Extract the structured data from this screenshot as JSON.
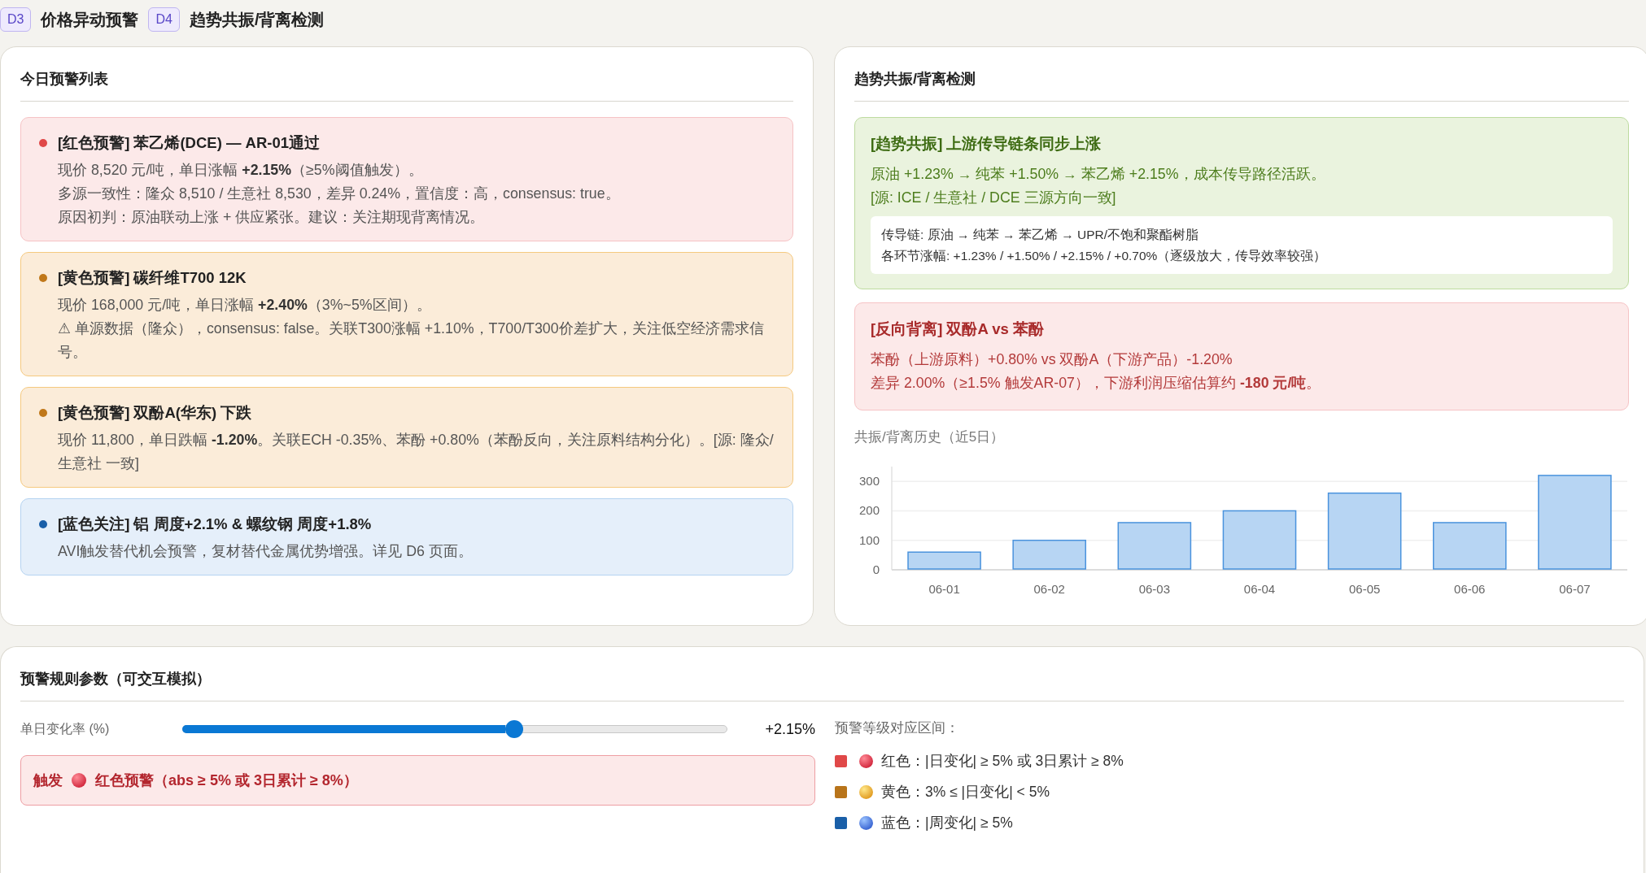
{
  "sections": [
    {
      "badge": "D3",
      "title": "价格异动预警"
    },
    {
      "badge": "D4",
      "title": "趋势共振/背离检测"
    }
  ],
  "alerts_panel": {
    "title": "今日预警列表",
    "alerts": [
      {
        "kind": "red",
        "color": "#e04848",
        "title": "[红色预警] 苯乙烯(DCE) — AR-01通过",
        "lines": [
          "现价 8,520 元/吨，单日涨幅 **+2.15%**（≥5%阈值触发）。",
          "多源一致性：隆众 8,510 / 生意社 8,530，差异 0.24%，置信度：高，consensus: true。",
          "原因初判：原油联动上涨 + 供应紧张。建议：关注期现背离情况。"
        ]
      },
      {
        "kind": "yellow",
        "color": "#c0781a",
        "title": "[黄色预警] 碳纤维T700 12K",
        "lines": [
          "现价 168,000 元/吨，单日涨幅 **+2.40%**（3%~5%区间）。",
          "⚠ 单源数据（隆众），consensus: false。关联T300涨幅 +1.10%，T700/T300价差扩大，关注低空经济需求信号。"
        ]
      },
      {
        "kind": "yellow",
        "color": "#c0781a",
        "title": "[黄色预警] 双酚A(华东) 下跌",
        "lines": [
          "现价 11,800，单日跌幅 **-1.20%**。关联ECH -0.35%、苯酚 +0.80%（苯酚反向，关注原料结构分化）。[源: 隆众/生意社 一致]"
        ]
      },
      {
        "kind": "blue",
        "color": "#1a5fa8",
        "title": "[蓝色关注] 铝 周度+2.1% & 螺纹钢 周度+1.8%",
        "lines": [
          "AVI触发替代机会预警，复材替代金属优势增强。详见 D6 页面。"
        ]
      }
    ]
  },
  "detection_panel": {
    "title": "趋势共振/背离检测",
    "signals": [
      {
        "kind": "resonance",
        "title": "[趋势共振] 上游传导链条同步上涨",
        "lines": [
          "原油 +1.23% → 纯苯 +1.50% → 苯乙烯 +2.15%，成本传导路径活跃。",
          "[源: ICE / 生意社 / DCE 三源方向一致]"
        ],
        "chain": [
          "传导链: 原油 → 纯苯 → 苯乙烯 → UPR/不饱和聚酯树脂",
          "各环节涨幅: +1.23% / +1.50% / +2.15% / +0.70%（逐级放大，传导效率较强）"
        ]
      },
      {
        "kind": "divergence",
        "title": "[反向背离] 双酚A vs 苯酚",
        "lines": [
          "苯酚（上游原料）+0.80% vs 双酚A（下游产品）-1.20%",
          "差异 2.00%（≥1.5% 触发AR-07），下游利润压缩估算约 **-180 元/吨**。"
        ]
      }
    ],
    "history": {
      "chart_data": {
        "type": "bar",
        "title": "共振/背离历史（近5日）",
        "categories": [
          "06-01",
          "06-02",
          "06-03",
          "06-04",
          "06-05",
          "06-06",
          "06-07"
        ],
        "values": [
          60,
          100,
          160,
          200,
          260,
          160,
          320
        ],
        "ylim": [
          0,
          350
        ],
        "yticks": [
          0,
          100,
          200,
          300
        ],
        "grid": true
      }
    }
  },
  "rules_panel": {
    "title": "预警规则参数（可交互模拟）",
    "slider": {
      "label": "单日变化率 (%)",
      "level": 0.61,
      "reading": "+2.15%"
    },
    "trigger": {
      "kind": "red",
      "label": "触发",
      "text": "红色预警（abs ≥ 5% 或 3日累计 ≥ 8%）"
    },
    "levels": {
      "title": "预警等级对应区间：",
      "items": [
        {
          "kind": "red",
          "color": "#e04848",
          "text": "红色：|日变化| ≥ 5% 或 3日累计 ≥ 8%"
        },
        {
          "kind": "yellow",
          "color": "#b8741a",
          "text": "黄色：3% ≤ |日变化| < 5%"
        },
        {
          "kind": "blue",
          "color": "#1a5fa8",
          "text": "蓝色：|周变化| ≥ 5%"
        }
      ]
    }
  }
}
